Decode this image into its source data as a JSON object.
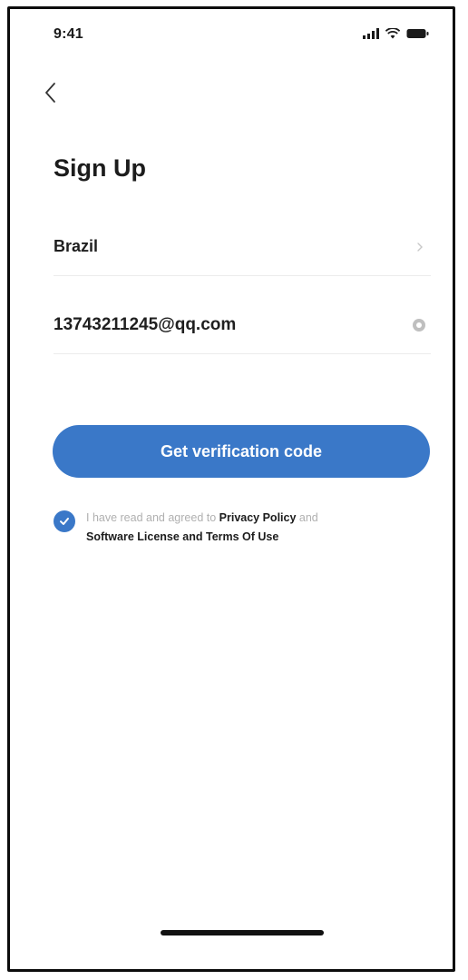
{
  "status_bar": {
    "time": "9:41",
    "icons": [
      "signal-icon",
      "wifi-icon",
      "battery-icon"
    ]
  },
  "header": {
    "back_icon": "chevron-left-icon",
    "title": "Sign Up"
  },
  "form": {
    "country": {
      "value": "Brazil",
      "icon": "chevron-right-icon"
    },
    "account": {
      "value": "13743211245@qq.com",
      "clear_icon": "clear-icon"
    },
    "submit_label": "Get verification code"
  },
  "agreement": {
    "checked": true,
    "prefix": "I have read and agreed to ",
    "privacy_link": "Privacy Policy",
    "conjunction": " and ",
    "license_link": "Software License and Terms Of Use"
  },
  "colors": {
    "accent": "#3a78c8",
    "title_text": "#1c1c1c",
    "muted_text": "#b0b0b0",
    "divider": "#ececec"
  }
}
